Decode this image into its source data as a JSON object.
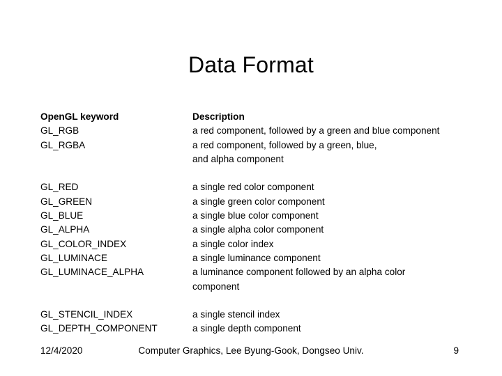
{
  "slide": {
    "title": "Data Format",
    "background_color": "#ffffff",
    "text_color": "#000000"
  },
  "table": {
    "headers": {
      "keyword": "OpenGL keyword",
      "description": "Description"
    },
    "rows": [
      {
        "keyword": "GL_RGB",
        "description": "a red component, followed by a green and blue component"
      },
      {
        "keyword": "GL_RGBA",
        "description": "a red component, followed by a green, blue,"
      },
      {
        "keyword": "",
        "description": "and alpha component"
      },
      {
        "keyword": "",
        "description": ""
      },
      {
        "keyword": "GL_RED",
        "description": "a single red color component"
      },
      {
        "keyword": "GL_GREEN",
        "description": "a single green color component"
      },
      {
        "keyword": "GL_BLUE",
        "description": "a single blue color component"
      },
      {
        "keyword": "GL_ALPHA",
        "description": "a single alpha color component"
      },
      {
        "keyword": "GL_COLOR_INDEX",
        "description": "a single color index"
      },
      {
        "keyword": "GL_LUMINACE",
        "description": "a single luminance component"
      },
      {
        "keyword": "GL_LUMINACE_ALPHA",
        "description": "a luminance component followed by an alpha color"
      },
      {
        "keyword": "",
        "description": "component"
      },
      {
        "keyword": "",
        "description": ""
      },
      {
        "keyword": "GL_STENCIL_INDEX",
        "description": "a single stencil index"
      },
      {
        "keyword": "GL_DEPTH_COMPONENT",
        "description": "a single depth component"
      }
    ]
  },
  "footer": {
    "date": "12/4/2020",
    "center": "Computer Graphics, Lee Byung-Gook, Dongseo Univ.",
    "page_number": "9"
  }
}
